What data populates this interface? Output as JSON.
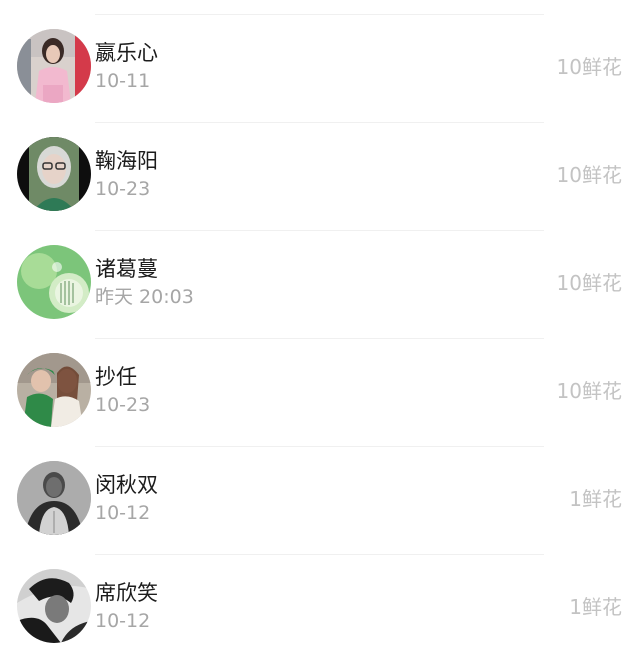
{
  "records": [
    {
      "name": "嬴乐心",
      "date": "10-11",
      "amount": "10鲜花",
      "avatar": "avatar-woman-pink"
    },
    {
      "name": "鞠海阳",
      "date": "10-23",
      "amount": "10鲜花",
      "avatar": "avatar-person-glasses"
    },
    {
      "name": "诸葛蔓",
      "date": "昨天 20:03",
      "amount": "10鲜花",
      "avatar": "avatar-green-art"
    },
    {
      "name": "抄任",
      "date": "10-23",
      "amount": "10鲜花",
      "avatar": "avatar-couple"
    },
    {
      "name": "闵秋双",
      "date": "10-12",
      "amount": "1鲜花",
      "avatar": "avatar-man-bw"
    },
    {
      "name": "席欣笑",
      "date": "10-12",
      "amount": "1鲜花",
      "avatar": "avatar-man-bw-2"
    }
  ]
}
